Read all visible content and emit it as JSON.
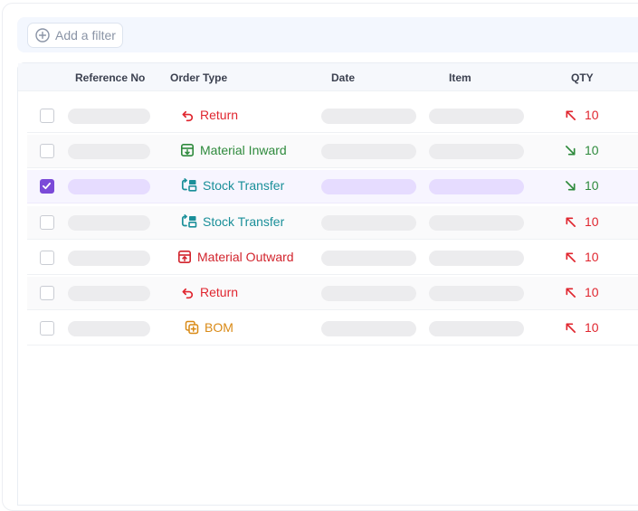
{
  "filter": {
    "add_label": "Add a filter"
  },
  "table": {
    "headers": {
      "reference_no": "Reference No",
      "order_type": "Order Type",
      "date": "Date",
      "item": "Item",
      "qty": "QTY"
    },
    "rows": [
      {
        "checked": false,
        "order_type": "Return",
        "icon": "return-icon",
        "type_color": "#e0262f",
        "qty": "10",
        "direction": "up",
        "qty_color": "#e0262f"
      },
      {
        "checked": false,
        "order_type": "Material Inward",
        "icon": "inward-box-icon",
        "type_color": "#2e8a3c",
        "qty": "10",
        "direction": "down",
        "qty_color": "#2e8a3c"
      },
      {
        "checked": true,
        "order_type": "Stock Transfer",
        "icon": "transfer-icon",
        "type_color": "#1a8f99",
        "qty": "10",
        "direction": "down",
        "qty_color": "#2e8a3c"
      },
      {
        "checked": false,
        "order_type": "Stock Transfer",
        "icon": "transfer-icon",
        "type_color": "#1a8f99",
        "qty": "10",
        "direction": "up",
        "qty_color": "#e0262f"
      },
      {
        "checked": false,
        "order_type": "Material Outward",
        "icon": "outward-box-icon",
        "type_color": "#d2242d",
        "qty": "10",
        "direction": "up",
        "qty_color": "#e0262f"
      },
      {
        "checked": false,
        "order_type": "Return",
        "icon": "return-icon",
        "type_color": "#e0262f",
        "qty": "10",
        "direction": "up",
        "qty_color": "#e0262f"
      },
      {
        "checked": false,
        "order_type": "BOM",
        "icon": "bom-icon",
        "type_color": "#d98a16",
        "qty": "10",
        "direction": "up",
        "qty_color": "#e0262f"
      }
    ]
  }
}
